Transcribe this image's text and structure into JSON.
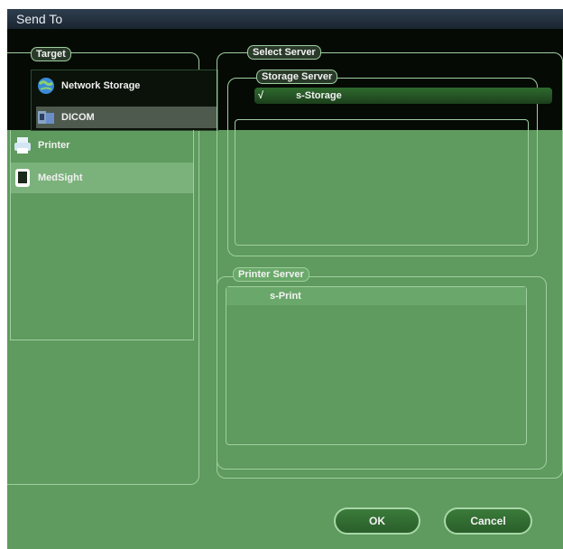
{
  "window": {
    "title": "Send To"
  },
  "target": {
    "legend": "Target",
    "items": [
      {
        "label": "Network Storage",
        "icon": "globe-icon"
      },
      {
        "label": "DICOM",
        "icon": "dicom-icon"
      },
      {
        "label": "Printer",
        "icon": "printer-icon"
      },
      {
        "label": "MedSight",
        "icon": "tablet-icon"
      }
    ]
  },
  "select_server": {
    "legend": "Select Server",
    "storage_server": {
      "legend": "Storage Server",
      "check": "√",
      "selected": "s-Storage"
    },
    "printer_server": {
      "legend": "Printer Server",
      "selected": "s-Print"
    }
  },
  "buttons": {
    "ok": "OK",
    "cancel": "Cancel"
  },
  "colors": {
    "panel_bg": "#5f9a5f",
    "selected_row": "#7bb27b",
    "titlebar": "#1a2530"
  }
}
